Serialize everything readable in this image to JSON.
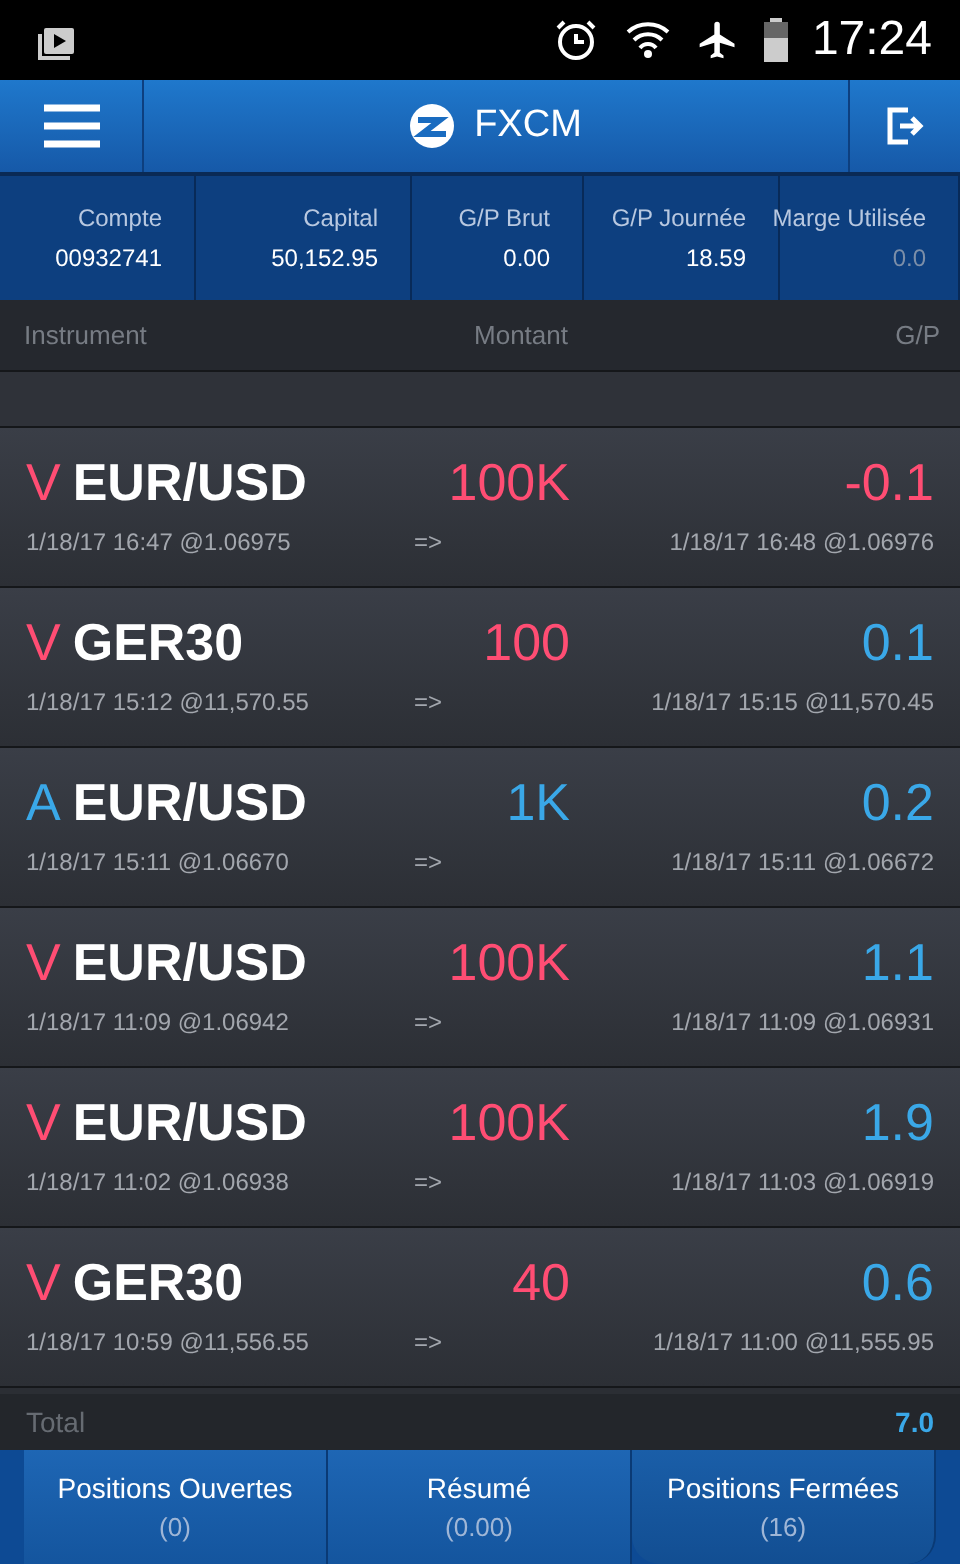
{
  "status_bar": {
    "time": "17:24"
  },
  "header": {
    "title": "FXCM"
  },
  "summary": [
    {
      "label": "Compte",
      "value": "00932741"
    },
    {
      "label": "Capital",
      "value": "50,152.95"
    },
    {
      "label": "G/P Brut",
      "value": "0.00"
    },
    {
      "label": "G/P Journée",
      "value": "18.59"
    },
    {
      "label": "Marge Utilisée",
      "value": "0.0"
    }
  ],
  "columns": [
    "Instrument",
    "Montant",
    "G/P"
  ],
  "rows": [
    {
      "side": "V",
      "sell": true,
      "instrument": "EUR/USD",
      "amount": "100K",
      "pl": "-0.1",
      "loss": true,
      "open": "1/18/17 16:47 @1.06975",
      "arrow": "=>",
      "close": "1/18/17 16:48 @1.06976"
    },
    {
      "side": "V",
      "sell": true,
      "instrument": "GER30",
      "amount": "100",
      "pl": "0.1",
      "loss": false,
      "open": "1/18/17 15:12 @11,570.55",
      "arrow": "=>",
      "close": "1/18/17 15:15 @11,570.45"
    },
    {
      "side": "A",
      "sell": false,
      "instrument": "EUR/USD",
      "amount": "1K",
      "pl": "0.2",
      "loss": false,
      "open": "1/18/17 15:11 @1.06670",
      "arrow": "=>",
      "close": "1/18/17 15:11 @1.06672"
    },
    {
      "side": "V",
      "sell": true,
      "instrument": "EUR/USD",
      "amount": "100K",
      "pl": "1.1",
      "loss": false,
      "open": "1/18/17 11:09 @1.06942",
      "arrow": "=>",
      "close": "1/18/17 11:09 @1.06931"
    },
    {
      "side": "V",
      "sell": true,
      "instrument": "EUR/USD",
      "amount": "100K",
      "pl": "1.9",
      "loss": false,
      "open": "1/18/17 11:02 @1.06938",
      "arrow": "=>",
      "close": "1/18/17 11:03 @1.06919"
    },
    {
      "side": "V",
      "sell": true,
      "instrument": "GER30",
      "amount": "40",
      "pl": "0.6",
      "loss": false,
      "open": "1/18/17 10:59 @11,556.55",
      "arrow": "=>",
      "close": "1/18/17 11:00 @11,555.95"
    }
  ],
  "total": {
    "label": "Total",
    "value": "7.0"
  },
  "tabs": [
    {
      "label": "Positions Ouvertes",
      "count": "(0)",
      "selected": false
    },
    {
      "label": "Résumé",
      "count": "(0.00)",
      "selected": false
    },
    {
      "label": "Positions Fermées",
      "count": "(16)",
      "selected": true
    }
  ]
}
